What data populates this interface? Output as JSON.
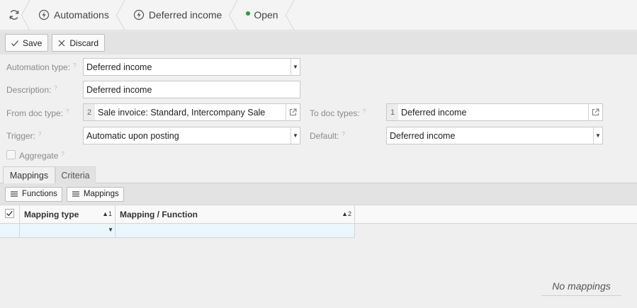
{
  "breadcrumb": {
    "refresh_icon": "refresh-icon",
    "items": [
      {
        "label": "Automations",
        "icon": "bolt-icon"
      },
      {
        "label": "Deferred income",
        "icon": "bolt-icon"
      },
      {
        "label": "Open",
        "status_color": "#2e9a3a"
      }
    ]
  },
  "toolbar": {
    "save_label": "Save",
    "discard_label": "Discard"
  },
  "form": {
    "automation_type": {
      "label": "Automation type:",
      "value": "Deferred income"
    },
    "description": {
      "label": "Description:",
      "value": "Deferred income"
    },
    "from_doc_type": {
      "label": "From doc type:",
      "count": "2",
      "value": "Sale invoice: Standard, Intercompany Sale"
    },
    "to_doc_types": {
      "label": "To doc types:",
      "count": "1",
      "value": "Deferred income"
    },
    "trigger": {
      "label": "Trigger:",
      "value": "Automatic upon posting"
    },
    "default": {
      "label": "Default:",
      "value": "Deferred income"
    },
    "aggregate": {
      "label": "Aggregate",
      "checked": false
    },
    "help_mark": "?"
  },
  "tabs": [
    {
      "label": "Mappings",
      "active": true
    },
    {
      "label": "Criteria",
      "active": false
    }
  ],
  "subtoolbar": {
    "functions_label": "Functions",
    "mappings_label": "Mappings"
  },
  "grid": {
    "columns": [
      {
        "label": "Mapping type",
        "sort": "▲1"
      },
      {
        "label": "Mapping / Function",
        "sort": "▲2"
      }
    ],
    "empty_text": "No mappings"
  },
  "colors": {
    "status_open": "#2e9a3a",
    "row_highlight": "#eaf6fb"
  }
}
